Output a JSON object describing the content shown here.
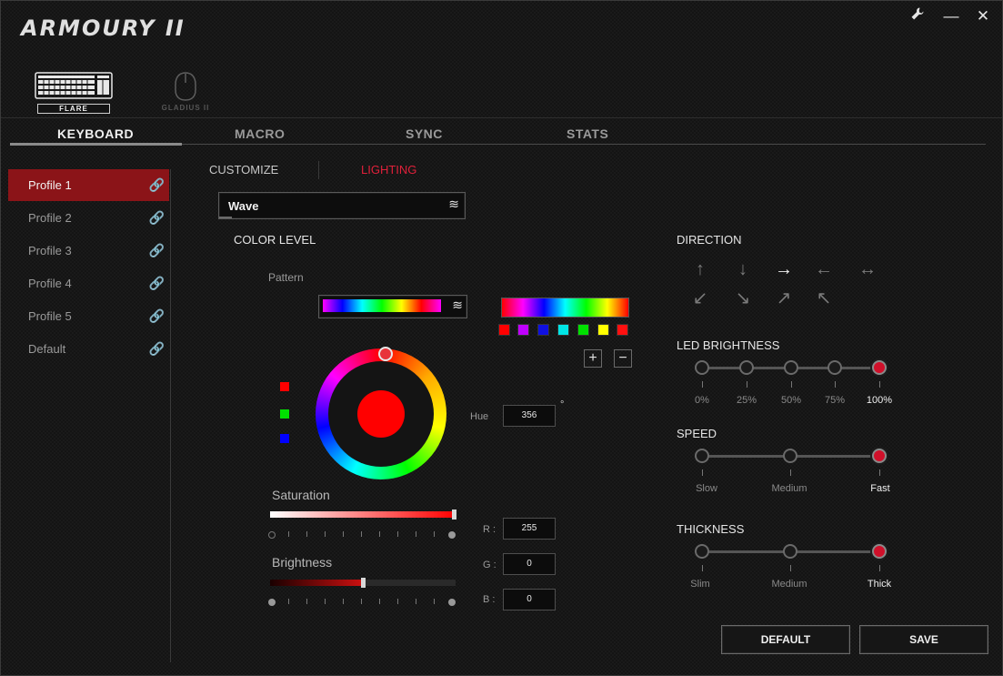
{
  "app": {
    "title": "ARMOURY II"
  },
  "window_controls": {
    "settings_icon": "wrench-icon",
    "minimize": "—",
    "close": "✕"
  },
  "devices": [
    {
      "name": "FLARE",
      "icon": "keyboard-icon",
      "selected": true
    },
    {
      "name": "GLADIUS II",
      "icon": "mouse-icon",
      "selected": false
    }
  ],
  "main_tabs": [
    "KEYBOARD",
    "MACRO",
    "SYNC",
    "STATS"
  ],
  "profiles": [
    "Profile 1",
    "Profile 2",
    "Profile 3",
    "Profile 4",
    "Profile 5",
    "Default"
  ],
  "sub_tabs": {
    "customize": "CUSTOMIZE",
    "lighting": "LIGHTING"
  },
  "effect_dropdown": {
    "value": "Wave"
  },
  "color_level": {
    "title": "COLOR LEVEL",
    "pattern_label": "Pattern",
    "swatches": [
      "#ff0000",
      "#c000ff",
      "#1010e0",
      "#00e5e5",
      "#00e000",
      "#ffff00",
      "#ff1010"
    ],
    "side_swatches": [
      "#ff0000",
      "#00e000",
      "#0000ff"
    ],
    "hue_label": "Hue",
    "hue_value": "356",
    "degree": "°",
    "saturation_label": "Saturation",
    "saturation": 1.0,
    "brightness_label": "Brightness",
    "brightness": 0.5,
    "r_label": "R :",
    "g_label": "G :",
    "b_label": "B :",
    "r": "255",
    "g": "0",
    "b": "0",
    "preview_color": "#ff0000",
    "add": "+",
    "remove": "−"
  },
  "direction": {
    "title": "DIRECTION",
    "arrows": [
      "↑",
      "↓",
      "→",
      "←",
      "↔",
      "↙",
      "↘",
      "↗",
      "↖"
    ],
    "selected": "→"
  },
  "led_brightness": {
    "title": "LED BRIGHTNESS",
    "options": [
      "0%",
      "25%",
      "50%",
      "75%",
      "100%"
    ],
    "selected": "100%"
  },
  "speed": {
    "title": "SPEED",
    "options": [
      "Slow",
      "Medium",
      "Fast"
    ],
    "selected": "Fast"
  },
  "thickness": {
    "title": "THICKNESS",
    "options": [
      "Slim",
      "Medium",
      "Thick"
    ],
    "selected": "Thick"
  },
  "buttons": {
    "default": "DEFAULT",
    "save": "SAVE"
  },
  "colors": {
    "accent": "#d0102a",
    "active_profile": "#8b1418",
    "lighting_tab": "#e0203a"
  }
}
